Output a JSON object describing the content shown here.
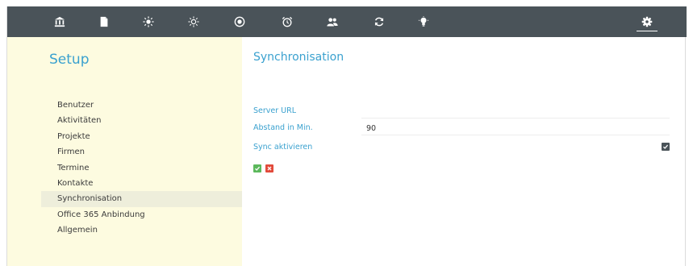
{
  "topbar": {
    "icons": [
      "bank-icon",
      "document-icon",
      "sun-icon",
      "brightness-icon",
      "record-icon",
      "alarm-clock-icon",
      "users-icon",
      "sync-icon",
      "lightbulb-icon",
      "gear-icon"
    ],
    "active_icon": "gear-icon",
    "background_color": "#4a5359"
  },
  "sidebar": {
    "title": "Setup",
    "items": [
      {
        "label": "Benutzer"
      },
      {
        "label": "Aktivitäten"
      },
      {
        "label": "Projekte"
      },
      {
        "label": "Firmen"
      },
      {
        "label": "Termine"
      },
      {
        "label": "Kontakte"
      },
      {
        "label": "Synchronisation",
        "active": true
      },
      {
        "label": "Office 365 Anbindung"
      },
      {
        "label": "Allgemein"
      }
    ],
    "background_color": "#fdfbe0"
  },
  "main": {
    "title": "Synchronisation",
    "form": {
      "server_url": {
        "label": "Server URL",
        "value": ""
      },
      "interval": {
        "label": "Abstand in Min.",
        "value": "90"
      },
      "sync_enabled": {
        "label": "Sync aktivieren",
        "checked": true
      }
    },
    "actions": {
      "save_icon": "check-icon",
      "cancel_icon": "close-icon",
      "save_color": "#5cb85c",
      "cancel_color": "#e24a3b"
    }
  },
  "accent_color": "#3aa1cf"
}
